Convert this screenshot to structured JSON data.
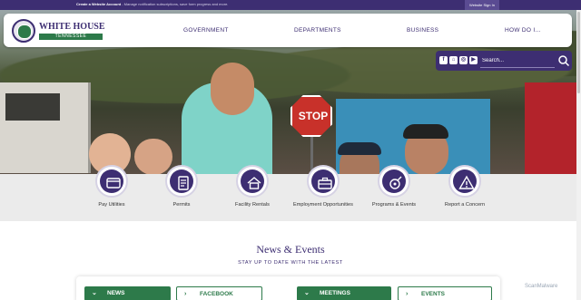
{
  "topbar": {
    "account_link": "Create a Website Account",
    "account_desc": " - Manage notification subscriptions, save form progress and more.",
    "sign_in": "Website Sign In"
  },
  "logo": {
    "name": "WHITE HOUSE",
    "state": "TENNESSEE"
  },
  "nav": [
    "GOVERNMENT",
    "DEPARTMENTS",
    "BUSINESS",
    "HOW DO I..."
  ],
  "social": [
    {
      "icon": "facebook-icon",
      "glyph": "f"
    },
    {
      "icon": "home-icon",
      "glyph": "⌂"
    },
    {
      "icon": "instagram-icon",
      "glyph": "◎"
    },
    {
      "icon": "youtube-icon",
      "glyph": "▶"
    }
  ],
  "search": {
    "placeholder": "Search..."
  },
  "hero": {
    "sign_text": "STOP"
  },
  "quick_links": [
    {
      "label": "Pay Utilities",
      "icon": "pay-utilities-icon"
    },
    {
      "label": "Permits",
      "icon": "permits-icon"
    },
    {
      "label": "Facility Rentals",
      "icon": "facility-rentals-icon"
    },
    {
      "label": "Employment Opportunities",
      "icon": "briefcase-icon"
    },
    {
      "label": "Programs & Events",
      "icon": "programs-events-icon"
    },
    {
      "label": "Report a Concern",
      "icon": "warning-icon"
    }
  ],
  "news": {
    "title": "News & Events",
    "subtitle": "STAY UP TO DATE WITH THE LATEST",
    "left_tabs": [
      "NEWS",
      "FACEBOOK"
    ],
    "right_tabs": [
      "MEETINGS",
      "EVENTS"
    ]
  },
  "watermark": "ScanMalware",
  "colors": {
    "brand_purple": "#3d2e72",
    "brand_green": "#2d7a4a"
  }
}
